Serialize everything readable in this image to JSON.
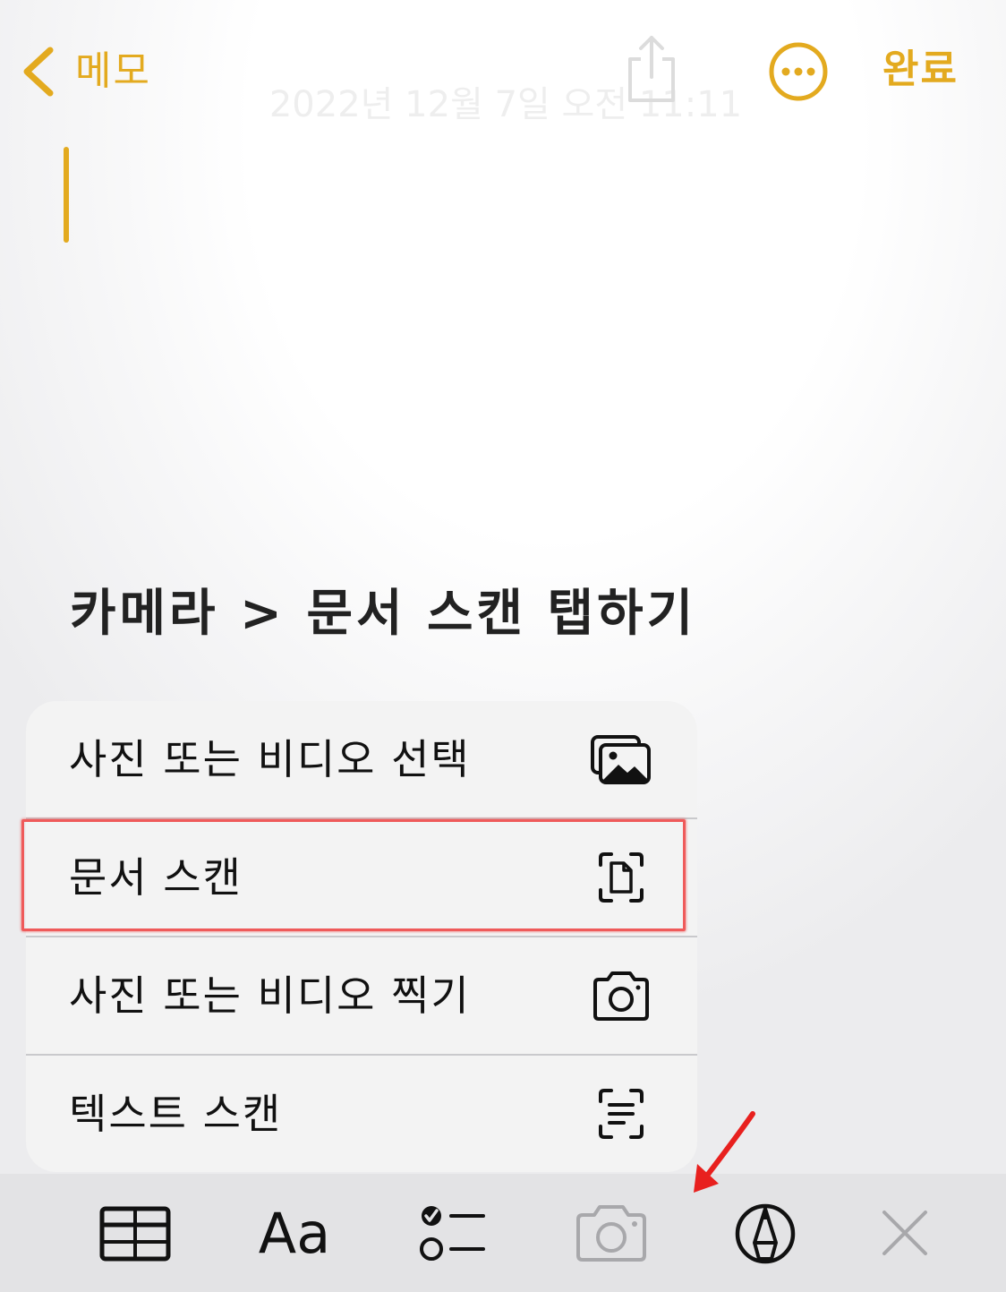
{
  "top_bar": {
    "back_label": "메모",
    "done_label": "완료",
    "date_text": "2022년 12월 7일 오전 11:11"
  },
  "instruction": "카메라 > 문서 스캔 탭하기",
  "menu": {
    "items": [
      {
        "label": "사진 또는 비디오 선택",
        "icon": "photo-library-icon"
      },
      {
        "label": "문서 스캔",
        "icon": "document-scan-icon"
      },
      {
        "label": "사진 또는 비디오 찍기",
        "icon": "camera-icon"
      },
      {
        "label": "텍스트 스캔",
        "icon": "text-scan-icon"
      }
    ]
  },
  "toolbar": {
    "format_label": "Aa",
    "icons": [
      "table-icon",
      "format-icon",
      "checklist-icon",
      "camera-icon",
      "markup-pen-icon",
      "close-icon"
    ]
  },
  "colors": {
    "accent": "#E3AA1F",
    "highlight": "#EF5A5A",
    "arrow": "#E8201E"
  }
}
